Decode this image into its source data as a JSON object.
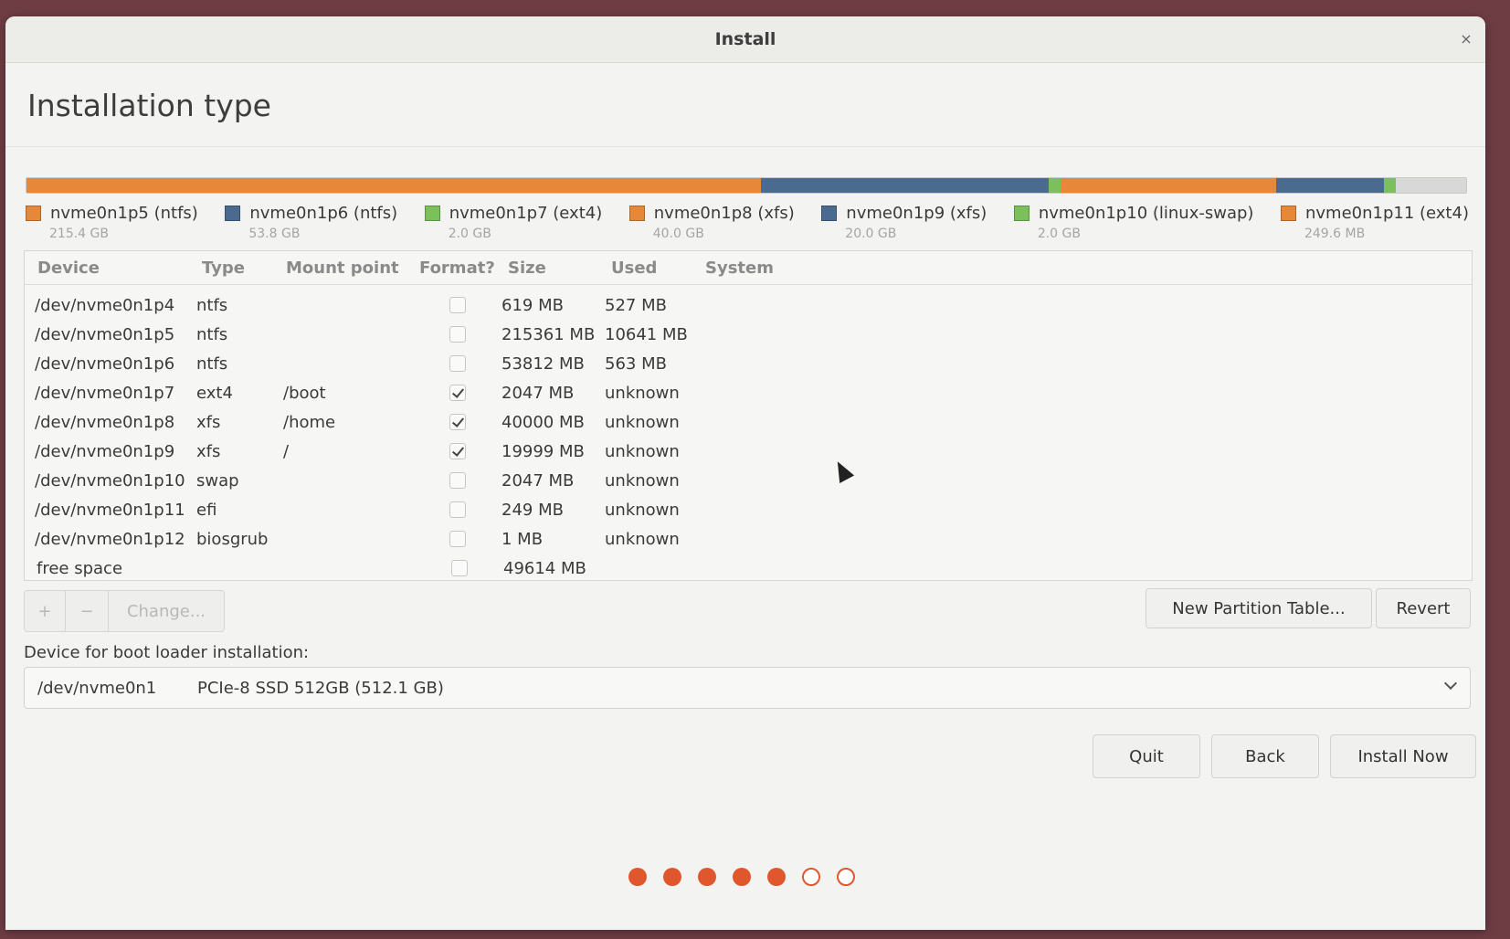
{
  "window": {
    "title": "Install",
    "close_glyph": "×"
  },
  "page": {
    "heading": "Installation type"
  },
  "diskbar": {
    "segments": [
      {
        "color": "#e5883a",
        "fraction": 0.51
      },
      {
        "color": "#4a6a8f",
        "fraction": 0.2
      },
      {
        "color": "#7bc05a",
        "fraction": 0.008
      },
      {
        "color": "#e5883a",
        "fraction": 0.15
      },
      {
        "color": "#4a6a8f",
        "fraction": 0.075
      },
      {
        "color": "#7bc05a",
        "fraction": 0.008
      },
      {
        "color": "#d8d8d8",
        "fraction": 0.049
      }
    ]
  },
  "legend": [
    {
      "label": "nvme0n1p5 (ntfs)",
      "size": "215.4 GB",
      "color": "#e5883a"
    },
    {
      "label": "nvme0n1p6 (ntfs)",
      "size": "53.8 GB",
      "color": "#4a6a8f"
    },
    {
      "label": "nvme0n1p7 (ext4)",
      "size": "2.0 GB",
      "color": "#7bc05a"
    },
    {
      "label": "nvme0n1p8 (xfs)",
      "size": "40.0 GB",
      "color": "#e5883a"
    },
    {
      "label": "nvme0n1p9 (xfs)",
      "size": "20.0 GB",
      "color": "#4a6a8f"
    },
    {
      "label": "nvme0n1p10 (linux-swap)",
      "size": "2.0 GB",
      "color": "#7bc05a"
    },
    {
      "label": "nvme0n1p11 (ext4)",
      "size": "249.6 MB",
      "color": "#e5883a"
    }
  ],
  "table": {
    "headers": {
      "device": "Device",
      "type": "Type",
      "mount": "Mount point",
      "format": "Format?",
      "size": "Size",
      "used": "Used",
      "system": "System"
    },
    "rows": [
      {
        "device": "/dev/nvme0n1p4",
        "type": "ntfs",
        "mount": "",
        "format": false,
        "size": "619 MB",
        "used": "527 MB"
      },
      {
        "device": "/dev/nvme0n1p5",
        "type": "ntfs",
        "mount": "",
        "format": false,
        "size": "215361 MB",
        "used": "10641 MB"
      },
      {
        "device": "/dev/nvme0n1p6",
        "type": "ntfs",
        "mount": "",
        "format": false,
        "size": "53812 MB",
        "used": "563 MB"
      },
      {
        "device": "/dev/nvme0n1p7",
        "type": "ext4",
        "mount": "/boot",
        "format": true,
        "size": "2047 MB",
        "used": "unknown"
      },
      {
        "device": "/dev/nvme0n1p8",
        "type": "xfs",
        "mount": "/home",
        "format": true,
        "size": "40000 MB",
        "used": "unknown"
      },
      {
        "device": "/dev/nvme0n1p9",
        "type": "xfs",
        "mount": "/",
        "format": true,
        "size": "19999 MB",
        "used": "unknown"
      },
      {
        "device": "/dev/nvme0n1p10",
        "type": "swap",
        "mount": "",
        "format": false,
        "size": "2047 MB",
        "used": "unknown"
      },
      {
        "device": "/dev/nvme0n1p11",
        "type": "efi",
        "mount": "",
        "format": false,
        "size": "249 MB",
        "used": "unknown"
      },
      {
        "device": "/dev/nvme0n1p12",
        "type": "biosgrub",
        "mount": "",
        "format": false,
        "size": "1 MB",
        "used": "unknown"
      },
      {
        "device": "free space",
        "type": "",
        "mount": "",
        "format": false,
        "size": "49614 MB",
        "used": ""
      }
    ]
  },
  "toolbar": {
    "add": "+",
    "remove": "−",
    "change": "Change...",
    "new_partition_table": "New Partition Table...",
    "revert": "Revert"
  },
  "bootloader": {
    "label": "Device for boot loader installation:",
    "device": "/dev/nvme0n1",
    "description": "PCIe-8 SSD 512GB (512.1 GB)"
  },
  "actions": {
    "quit": "Quit",
    "back": "Back",
    "install_now": "Install Now"
  },
  "progress": {
    "completed_steps": 5,
    "total_steps": 7
  }
}
